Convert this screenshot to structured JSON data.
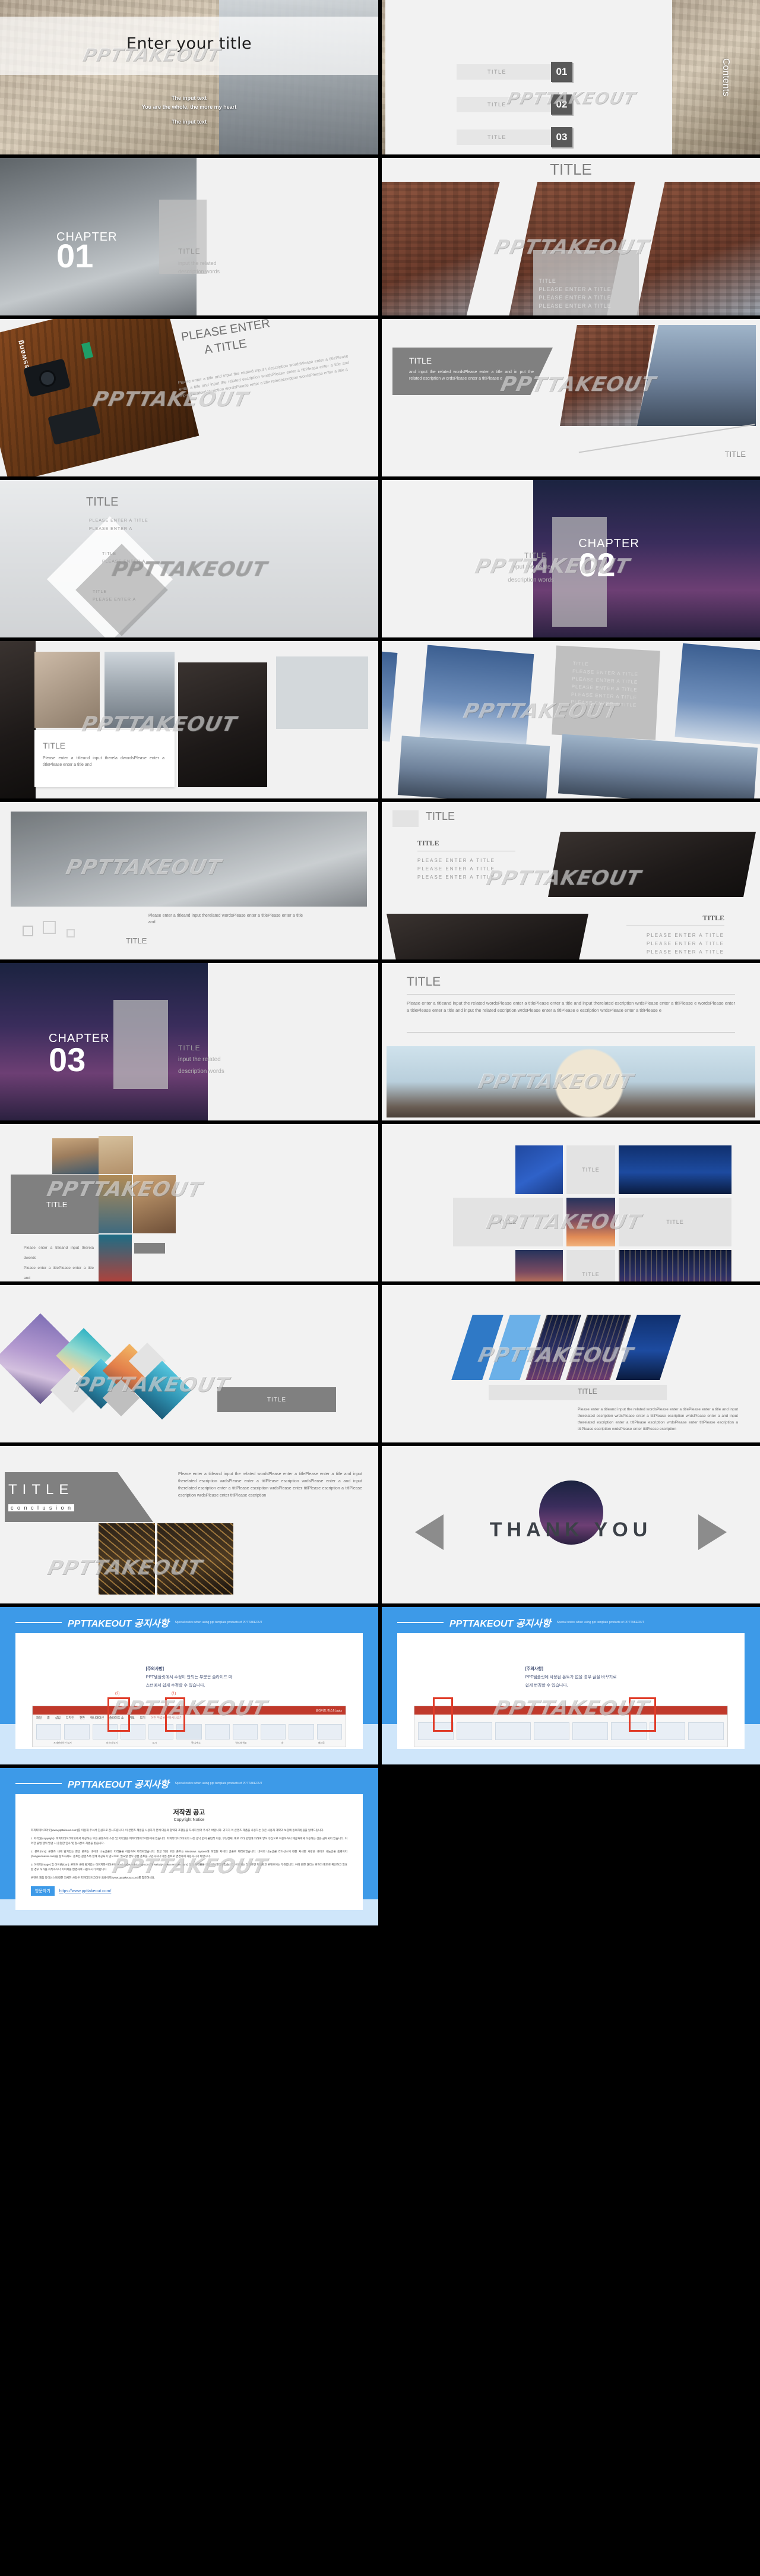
{
  "meta": {
    "watermark": "PPTTAKEOUT",
    "accent_blue": "#3d9ae8",
    "gray": "#808080"
  },
  "slides": {
    "cover": {
      "title": "Enter your title",
      "line1": "The input text",
      "line2": "You are the whole, the more my heart",
      "line3": "The input text"
    },
    "contents": {
      "heading": "Contents",
      "items": [
        {
          "label": "TITLE",
          "num": "01"
        },
        {
          "label": "TITLE",
          "num": "02"
        },
        {
          "label": "TITLE",
          "num": "03"
        }
      ]
    },
    "chapter01": {
      "word": "CHAPTER",
      "num": "01",
      "title": "TITLE",
      "desc1": "input the related",
      "desc2": "description words"
    },
    "chapter02": {
      "word": "CHAPTER",
      "num": "02",
      "title": "TITLE",
      "desc1": "input the related",
      "desc2": "description words"
    },
    "chapter03": {
      "word": "CHAPTER",
      "num": "03",
      "title": "TITLE",
      "desc1": "input the related",
      "desc2": "description words"
    },
    "diag_title": {
      "title": "TITLE",
      "list": [
        "TITLE",
        "PLEASE ENTER A TITLE",
        "PLEASE ENTER A TITLE",
        "PLEASE ENTER A TITLE"
      ]
    },
    "camera": {
      "title_l1": "PLEASE  ENTER",
      "title_l2": "A TITLE",
      "brand": "misswang",
      "body": "Please enter a title and input the related input t description  wordsPlease  enter  a  titlePlease enter  a  title  and  input  the  related  escription wordsPlease  enter  a  titlPlease  enter  a  title  and input  the  retedescription  wordsPlease  enter  a title retedescription wordsPlease enter a title a"
    },
    "arrow_title": {
      "title": "TITLE",
      "body": "and input the related wordsPlease enter a title and in put the related escription w ordsPlease enter a titlPlease e",
      "corner": "TITLE"
    },
    "tri_title": {
      "title": "TITLE",
      "l1": "PLEASE ENTER A TITLE",
      "l2": "PLEASE ENTER A",
      "l3": "TITLE",
      "l4": "PLEASE ENTER A",
      "l5": "TITLE",
      "l6": "PLEASE ENTER A"
    },
    "photo_cards": {
      "title": "TITLE",
      "body": "Please enter a titleand input therela dwordsPlease enter a titlePlease enter a title and"
    },
    "tilt_list": {
      "title": "TITLE",
      "list": [
        "PLEASE ENTER A TITLE",
        "PLEASE ENTER A TITLE",
        "PLEASE ENTER A TITLE",
        "PLEASE ENTER A TITLE",
        "PLEASE ENTER A TITLE"
      ]
    },
    "louvre": {
      "title": "TITLE",
      "caption": "TITLE",
      "body": "Please enter a titleand input therelated wordsPlease enter a titlePlease enter a title and"
    },
    "two_band": {
      "title": "TITLE",
      "sub": "TITLE",
      "l1": "PLEASE ENTER A TITLE",
      "l2": "PLEASE ENTER A TITLE",
      "l3": "PLEASE ENTER A TITLE",
      "title2": "TITLE",
      "r1": "PLEASE ENTER A TITLE",
      "r2": "PLEASE ENTER A TITLE",
      "r3": "PLEASE ENTER A TITLE"
    },
    "flower": {
      "title": "TITLE",
      "body": "Please enter a titleand input the related wordsPlease enter a titlePlease enter a title and input therelated escription wrdsPlease enter a titlPlease e wordsPlease enter a titlePlease enter a title and input the related escription wrdsPlease enter a titlPlease e escription wrdsPlease enter a titlPlease e"
    },
    "venice": {
      "title": "TITLE",
      "body1": "Please enter a titleand input therela dwords",
      "body2": "Please enter a titlePlease enter a title and"
    },
    "blue_grid": {
      "title1": "TITLE",
      "title2": "TITLE",
      "title3": "TITLE",
      "title4": "TITLE"
    },
    "diamonds": {
      "title": "TITLE"
    },
    "slant": {
      "title": "TITLE"
    },
    "conclusion": {
      "title": "TITLE",
      "sub": "c o n c l u s i o n",
      "body": "Please enter a titleand input the related wordsPlease enter a titlePlease enter a title and input therelated escription wrdsPlease enter a titlPlease escription wrdsPlease enter a and input therelated escription  enter a titlPlease escription wrdsPlease enter titlPlease escription a titlPlease escription wrdsPlease enter titlPlease escription"
    },
    "thankyou": {
      "text": "THANK YOU"
    },
    "notice_master": {
      "header": "PPTTAKEOUT 공지사항",
      "subheader": "Special notice when using ppt template products of PPTTAKEOUT",
      "note_title": "[주의사항]",
      "note_l1": "PPT템플릿에서 수정이 안되는 부분은 슬라이드 마",
      "note_l2": "스터에서 쉽게 수정할 수 있습니다.",
      "ribbon_file": "슬라이드 마스터.pptx",
      "marker1": "(1)",
      "marker2": "(2)",
      "tabs": [
        "파일",
        "홈",
        "삽입",
        "디자인",
        "전환",
        "애니메이션",
        "슬라이드 쇼",
        "검토",
        "보기",
        "어떤 작업을 원하시나요?"
      ],
      "groups": [
        "프레젠테이션 보기",
        "마스터 보기",
        "표시",
        "확대/축소",
        "컬러/회색조",
        "창",
        "매크로"
      ]
    },
    "notice_font": {
      "header": "PPTTAKEOUT 공지사항",
      "subheader": "Special notice when using ppt template products of PPTTAKEOUT",
      "note_title": "[주의사항]",
      "note_l1": "PPT템플릿에 사용된 폰트가 없을 경우 글꼴 바꾸기로",
      "note_l2": "쉽게 변경할 수 있습니다."
    },
    "copyright": {
      "header": "PPTTAKEOUT 공지사항",
      "subheader": "Special notice when using ppt template products of PPTTAKEOUT",
      "title_ko": "저작권 공고",
      "title_en": "Copyright Notice",
      "p_intro": "피피티테이크아웃(www.ppttakeout.com)를 이용해 주셔서 진심으로 감사드립니다. 이 콘텐츠 제품을 사용하기 전에 다음의 협약과 조항들을 자세히 읽어 주시기 바랍니다. 귀하가 이 콘텐츠 제품을 사용하는 것은 사용자 계약과 보증에 동의하셨음을 알려드립니다.",
      "p1": "1. 저작권(copyright): 피피티테이크아웃에서 제공하는 모든 콘텐츠의 소유 및 저작권은 피피티테이크아웃에게 있습니다. 피피티테이크아웃의 사전 승낙 없이 불법적 이용, 무단전재, 배포 기타 방법에 의하여 양도 유상으로 이용하거나 제삼자에게 이용하는 것은 금지되어 있습니다. 이러한 불법 행위 발견 시 준엄한 민사 및 형사상의 처벌을 받습니다.",
      "p2": "2. 폰트(font): 콘텐츠 내에 담겨있는 한글 폰트는 네이버 나눔글꼴의 저작물을 이용하여 저작되었습니다. 한글 외의 모든 폰트는 Windows System에 포함된 자체의 글꼴로 제작되었습니다. 네이버 나눔글꼴 라이선스에 대한 자세한 사항은 네이버 나눔글꼴 홈페이지(hangeul.naver.com)를 참조하세요. 폰트는 콘텐츠와 함께 제공되지 않으므로, 필요할 경우 정품 폰트를 구입하거나 다른 폰트로 변경하여 사용하시기 바랍니다.",
      "p3": "3. 이미지(image) 및 아이콘(icon): 콘텐츠 내에 담겨있는 이미지와 아이콘은 Pixabay(www.pixabay.com)와 Webalys(www.webalys.com) 등의 저작물을 이용하여 제작되었습니다. 이미지는 참고로만 제공되고 콘텐츠에는 무관합니다. 이에 관한 권리는 귀하가 별도로 확인하고 필요할 경우 허가를 취득하거나 이미지를 변경하여 사용하시기 바랍니다.",
      "p_outro": "콘텐츠 제품 라이선스에 대한 자세한 사항은 피피티테이크아웃 홈페이지(www.ppttakeout.com)를 참조하세요.",
      "button": "방문하기",
      "link": "https://www.ppttakeout.com/"
    }
  }
}
